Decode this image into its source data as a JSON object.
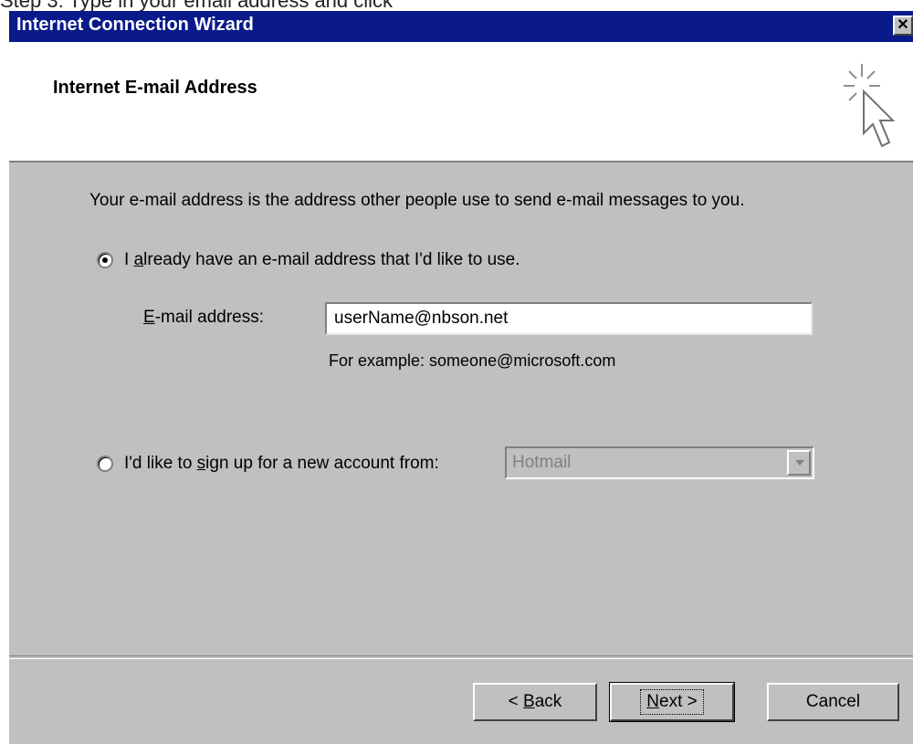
{
  "caption": "Step 3: Type in your email address and click",
  "window": {
    "title": "Internet Connection Wizard",
    "close_symbol": "✕"
  },
  "header": {
    "title": "Internet E-mail Address",
    "icon": "wizard-cursor-icon"
  },
  "body": {
    "description": "Your e-mail address is the address other people use to send e-mail messages to you.",
    "option_existing": {
      "pre": "I ",
      "mnemonic": "a",
      "post": "lready have an e-mail address that I'd like to use.",
      "checked": true
    },
    "email_label": {
      "mnemonic": "E",
      "rest": "-mail address:"
    },
    "email_value": "userName@nbson.net",
    "example": "For example: someone@microsoft.com",
    "option_new": {
      "pre": "I'd like to ",
      "mnemonic": "s",
      "post": "ign up for a new account from:",
      "checked": false
    },
    "provider_select": {
      "value": "Hotmail",
      "disabled": true
    }
  },
  "buttons": {
    "back": {
      "pre": "< ",
      "mnemonic": "B",
      "post": "ack"
    },
    "next": {
      "mnemonic": "N",
      "post": "ext >"
    },
    "cancel": "Cancel"
  }
}
